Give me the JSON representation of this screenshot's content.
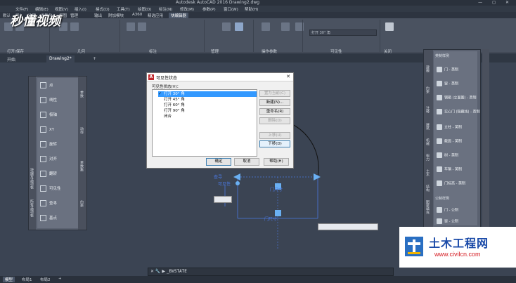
{
  "app": {
    "title": "Autodesk AutoCAD 2016   Drawing2.dwg",
    "window_controls": "— ◻ ✕"
  },
  "watermark": "秒懂视频",
  "menubar": [
    "文件(F)",
    "编辑(E)",
    "视图(V)",
    "插入(I)",
    "格式(O)",
    "工具(T)",
    "绘图(D)",
    "标注(N)",
    "修改(M)",
    "参数(P)",
    "窗口(W)",
    "帮助(H)"
  ],
  "ribbon_tabs": [
    "默认",
    "插入",
    "注释",
    "参数化",
    "视图",
    "管理",
    "输出",
    "附加模块",
    "A360",
    "精选应用",
    "块编辑器"
  ],
  "ribbon_tab_active": "块编辑器",
  "ribbon_panels": [
    "打开/保存",
    "几何",
    "标注",
    "管理",
    "操作参数",
    "可见性",
    "关闭"
  ],
  "visibility_state_field": "打开 30°  角",
  "doc_tabs": [
    "开始",
    "Drawing2*"
  ],
  "left_palette": {
    "items": [
      "点",
      "线性",
      "极轴",
      "XY",
      "旋转",
      "对齐",
      "翻转",
      "可见性",
      "查寻",
      "基点"
    ],
    "side_tabs": [
      "参数",
      "动作",
      "参数集",
      "约束"
    ],
    "strip_labels": [
      "块编写选项板",
      "所有选项板"
    ]
  },
  "right_palette": {
    "header": "英制样例",
    "items": [
      "门 - 英制",
      "窗 - 英制",
      "钢箱 (立面图) - 英制",
      "实心门 (隐藏线) - 英制",
      "立柱 - 英制",
      "截面 - 英制",
      "树 - 英制",
      "车辆 - 英制",
      "门标高 - 英制"
    ],
    "section2": "公制样例",
    "items2": [
      "门 - 公制",
      "窗 - 公制"
    ],
    "side_tabs": [
      "建模",
      "约束",
      "注释",
      "建筑",
      "机械",
      "电力",
      "土木",
      "结构",
      "图案填充"
    ]
  },
  "dialog": {
    "title": "可见性状态",
    "list_label": "可见性状态(V)：",
    "states": [
      "打开 30°  角",
      "打开 45°  角",
      "打开 60°  角",
      "打开 90°  角",
      "闭合"
    ],
    "selected_index": 0,
    "buttons": {
      "set_current": "置为当前(C)",
      "new": "新建(N)...",
      "rename": "重命名(R)",
      "delete": "删除(D)",
      "move_up": "上移(U)",
      "move_down": "下移(D)"
    },
    "ok": "确定",
    "cancel": "取消",
    "help": "帮助(H)"
  },
  "annotations": {
    "vis_label": "可见性",
    "lookup_label": "查寻",
    "door_width": "门尺寸",
    "param_label": "门尺寸"
  },
  "command_line": {
    "prompt": "✕ 🔧 ▶",
    "value": "_BVSTATE"
  },
  "status_tabs": [
    "模型",
    "布局1",
    "布局2"
  ],
  "status_active": "模型",
  "brand_logo": {
    "title": "土木工程网",
    "url": "www.civilcn.com"
  },
  "colors": {
    "accent": "#3399ff",
    "annotation": "#4b78e0",
    "logo_blue": "#1a4aa8",
    "logo_red": "#d51a21"
  }
}
